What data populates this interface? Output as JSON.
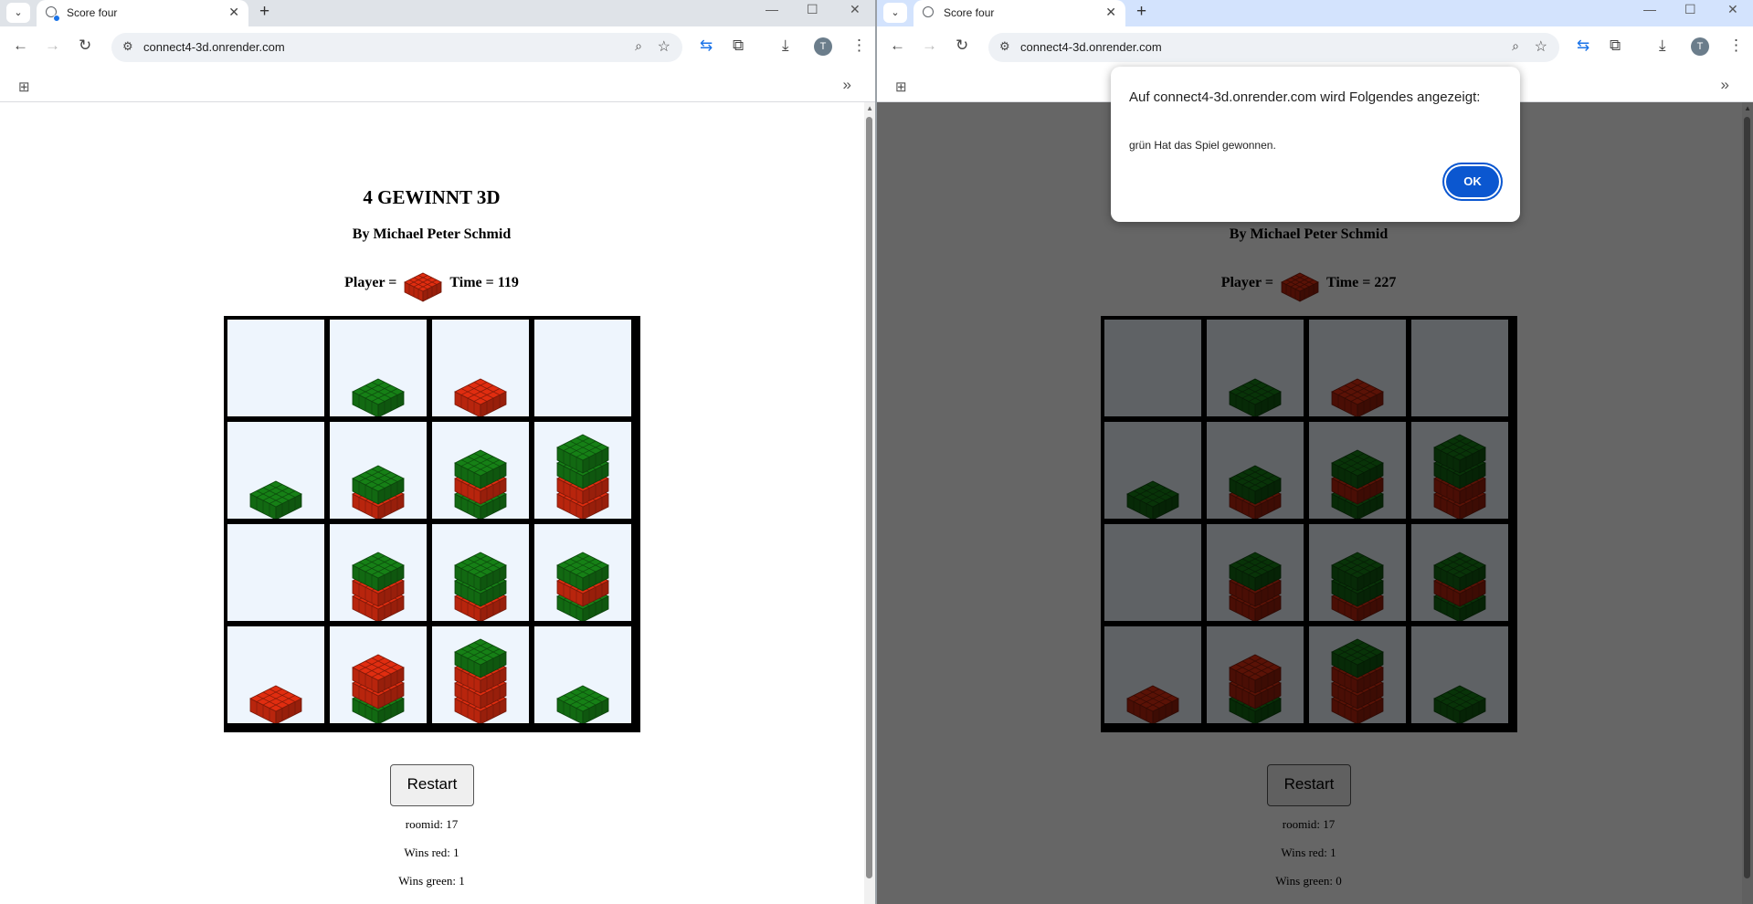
{
  "colors": {
    "red": "#e02d10",
    "green": "#168016",
    "board_bg": "#eef5fd"
  },
  "browser": {
    "tab_title": "Score four",
    "url": "connect4-3d.onrender.com",
    "profile_initial": "T",
    "icons": [
      "tab-search-icon",
      "globe-icon",
      "close-icon",
      "new-tab-icon",
      "minimize-icon",
      "maximize-icon",
      "back-icon",
      "forward-icon",
      "reload-icon",
      "tune-icon",
      "zoom-icon",
      "star-icon",
      "translate-icon",
      "extensions-icon",
      "download-icon",
      "kebab-menu-icon",
      "apps-icon",
      "chevron-more-icon"
    ]
  },
  "game": {
    "title": "4 GEWINNT 3D",
    "author": "By Michael Peter Schmid",
    "player_label": "Player =",
    "time_label": "Time =",
    "restart_label": "Restart",
    "roomid_label": "roomid:",
    "wins_red_label": "Wins red:",
    "wins_green_label": "Wins green:",
    "board": [
      [
        [],
        [
          "G"
        ],
        [
          "R"
        ],
        []
      ],
      [
        [
          "G"
        ],
        [
          "R",
          "G"
        ],
        [
          "G",
          "R",
          "G"
        ],
        [
          "R",
          "R",
          "G",
          "G"
        ]
      ],
      [
        [],
        [
          "R",
          "R",
          "G"
        ],
        [
          "R",
          "G",
          "G"
        ],
        [
          "G",
          "R",
          "G"
        ]
      ],
      [
        [
          "R"
        ],
        [
          "G",
          "R",
          "R"
        ],
        [
          "R",
          "R",
          "R",
          "G"
        ],
        [
          "G"
        ]
      ]
    ]
  },
  "left": {
    "current_player": "red",
    "time": "119",
    "roomid": "17",
    "wins_red": "1",
    "wins_green": "1"
  },
  "right": {
    "current_player": "red",
    "time": "227",
    "roomid": "17",
    "wins_red": "1",
    "wins_green": "0"
  },
  "dialog": {
    "title": "Auf connect4-3d.onrender.com wird Folgendes angezeigt:",
    "message": "grün Hat das Spiel gewonnen.",
    "ok_label": "OK"
  }
}
